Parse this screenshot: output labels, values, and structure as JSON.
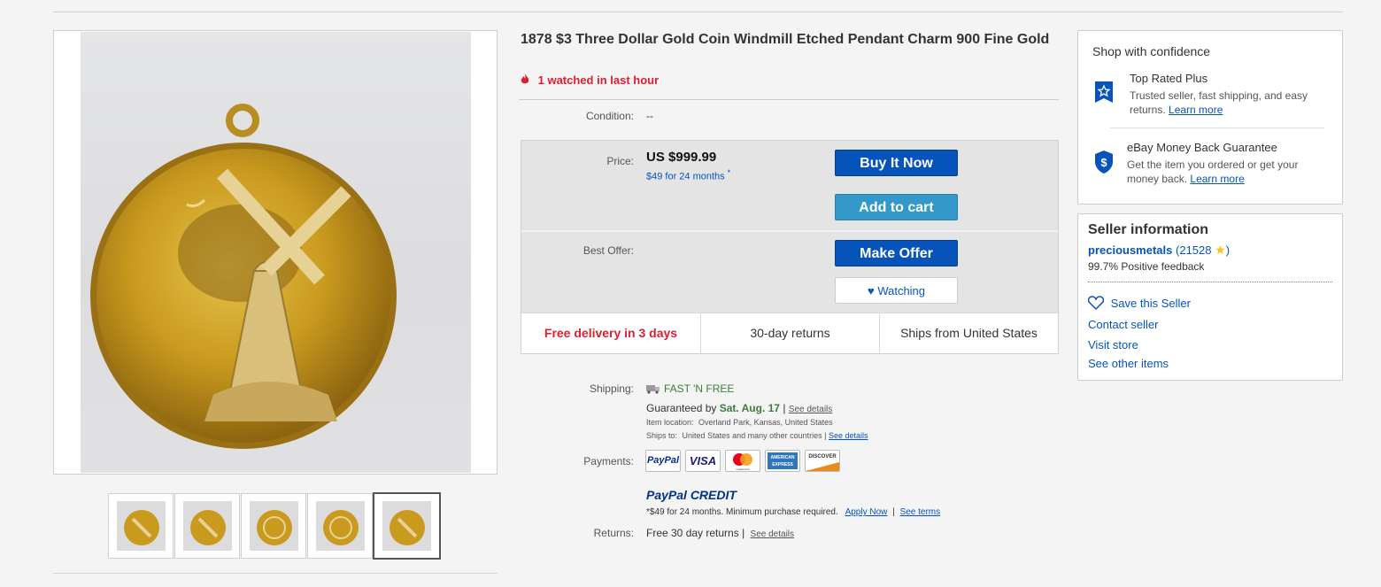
{
  "title": "1878 $3 Three Dollar Gold Coin Windmill Etched Pendant Charm 900 Fine Gold",
  "watch_count_text": "1 watched in last hour",
  "condition": {
    "label": "Condition:",
    "value": "--"
  },
  "price": {
    "label": "Price:",
    "amount": "US $999.99",
    "finance": "$49 for 24 months",
    "finance_mark": "*"
  },
  "best_offer_label": "Best Offer:",
  "buttons": {
    "buy_now": "Buy It Now",
    "add_to_cart": "Add to cart",
    "make_offer": "Make Offer",
    "watching": "Watching"
  },
  "highlights": [
    "Free delivery in 3 days",
    "30-day returns",
    "Ships from United States"
  ],
  "shipping": {
    "label": "Shipping:",
    "method": "FAST 'N FREE",
    "guaranteed_prefix": "Guaranteed by",
    "guaranteed_date": "Sat. Aug. 17",
    "separator": "|",
    "see_details": "See details",
    "item_location_label": "Item location:",
    "item_location": "Overland Park, Kansas, United States",
    "ships_to_label": "Ships to:",
    "ships_to": "United States and many other countries",
    "ships_see_details": "See details"
  },
  "payments": {
    "label": "Payments:",
    "methods": [
      "PayPal",
      "VISA",
      "mastercard",
      "AMERICAN EXPRESS",
      "DISCOVER"
    ],
    "credit_brand": "PayPal CREDIT",
    "credit_note": "*$49 for 24 months. Minimum purchase required.",
    "apply_now": "Apply Now",
    "pipe": "|",
    "see_terms": "See terms"
  },
  "returns": {
    "label": "Returns:",
    "value": "Free 30 day returns",
    "pipe": "|",
    "see_details": "See details"
  },
  "confidence": {
    "heading": "Shop with confidence",
    "items": [
      {
        "title": "Top Rated Plus",
        "desc": "Trusted seller, fast shipping, and easy returns.",
        "link": "Learn more"
      },
      {
        "title": "eBay Money Back Guarantee",
        "desc": "Get the item you ordered or get your money back.",
        "link": "Learn more"
      }
    ]
  },
  "seller": {
    "heading": "Seller information",
    "name": "preciousmetals",
    "score_open": "(",
    "score": "21528",
    "score_close": ")",
    "feedback": "99.7% Positive feedback",
    "save": "Save this Seller",
    "contact": "Contact seller",
    "visit": "Visit store",
    "other": "See other items"
  },
  "colors": {
    "link_blue": "#0654ba",
    "watch_red": "#dd1e31",
    "fast_free_green": "#3a7d3a",
    "button_blue": "#0654ba",
    "cart_blue": "#3498ca",
    "gold": "#c9a227"
  },
  "icons": [
    "flame-icon",
    "star-badge-icon",
    "shield-dollar-icon",
    "heart-icon",
    "truck-icon",
    "rating-star-icon"
  ]
}
